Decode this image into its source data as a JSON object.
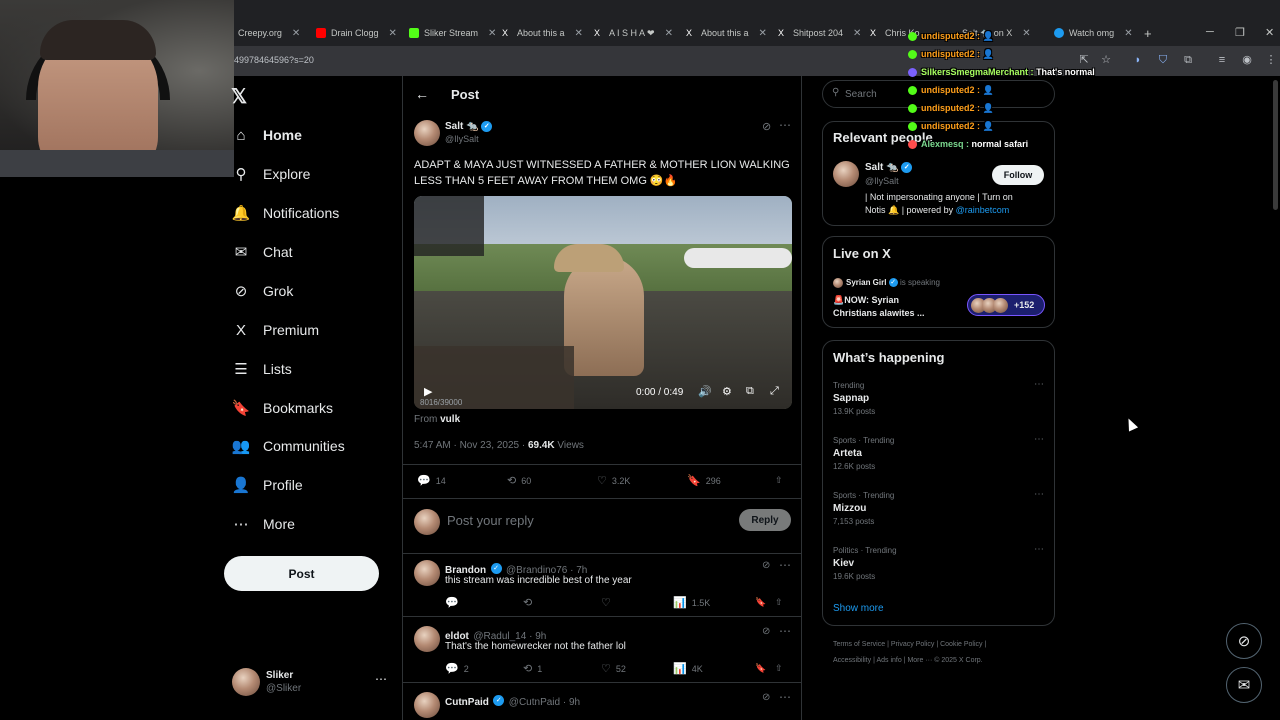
{
  "browser": {
    "tabs": [
      {
        "label": "Creepy.org",
        "color": "#ffffff"
      },
      {
        "label": "Drain Clogg",
        "color": "#ff0000"
      },
      {
        "label": "Sliker Stream",
        "color": "#53fc18"
      },
      {
        "label": "About this a",
        "color": "#ffffff"
      },
      {
        "label": "A I S H A ❤",
        "color": "#ffffff"
      },
      {
        "label": "About this a",
        "color": "#ffffff"
      },
      {
        "label": "Shitpost 204",
        "color": "#ffffff"
      },
      {
        "label": "Chris Ko",
        "color": "#ffffff"
      },
      {
        "label": "Salt 🐀 on X",
        "color": "#ffffff"
      },
      {
        "label": "Watch omg",
        "color": "#1d9bf0"
      }
    ],
    "url": "49978464596?s=20"
  },
  "nav": {
    "items": [
      {
        "label": "Home",
        "icon": "home-icon",
        "glyph": "⌂"
      },
      {
        "label": "Explore",
        "icon": "search-icon",
        "glyph": "⚲"
      },
      {
        "label": "Notifications",
        "icon": "bell-icon",
        "glyph": "🔔"
      },
      {
        "label": "Chat",
        "icon": "mail-icon",
        "glyph": "✉"
      },
      {
        "label": "Grok",
        "icon": "grok-icon",
        "glyph": "⊘"
      },
      {
        "label": "Premium",
        "icon": "x-logo-icon",
        "glyph": "X"
      },
      {
        "label": "Lists",
        "icon": "list-icon",
        "glyph": "☰"
      },
      {
        "label": "Bookmarks",
        "icon": "bookmark-icon",
        "glyph": "🔖"
      },
      {
        "label": "Communities",
        "icon": "people-icon",
        "glyph": "👥"
      },
      {
        "label": "Profile",
        "icon": "person-icon",
        "glyph": "👤"
      },
      {
        "label": "More",
        "icon": "more-circle-icon",
        "glyph": "⋯"
      }
    ],
    "post_label": "Post",
    "account": {
      "name": "Sliker",
      "handle": "@Sliker"
    }
  },
  "post": {
    "header_title": "Post",
    "author_name": "Salt 🐀",
    "author_handle": "@IlySalt",
    "text": "ADAPT & MAYA JUST WITNESSED A FATHER & MOTHER LION WALKING LESS THAN 5 FEET AWAY FROM THEM OMG 😳🔥",
    "video_time": "0:00 / 0:49",
    "video_overlay": "8016/39000",
    "from_label": "From",
    "from_source": "vulk",
    "timestamp": "5:47 AM · Nov 23, 2025 ·",
    "views": "69.4K",
    "views_label": "Views",
    "stats": {
      "replies": "14",
      "reposts": "60",
      "likes": "3.2K",
      "bookmarks": "296"
    },
    "reply_placeholder": "Post your reply",
    "reply_button": "Reply"
  },
  "replies": [
    {
      "name": "Brandon",
      "handle": "@Brandino76 · 7h",
      "text": "this stream was incredible best of the year",
      "verified": true,
      "comments": "",
      "reposts": "",
      "likes": "",
      "views": "1.5K"
    },
    {
      "name": "eldot",
      "handle": "@Radul_14 · 9h",
      "text": "That's the homewrecker not the father lol",
      "verified": false,
      "comments": "2",
      "reposts": "1",
      "likes": "52",
      "views": "4K"
    },
    {
      "name": "CutnPaid",
      "handle": "@CutnPaid · 9h",
      "text": "",
      "verified": true,
      "comments": "",
      "reposts": "",
      "likes": "",
      "views": ""
    }
  ],
  "sidebar": {
    "search_placeholder": "Search",
    "relevant_title": "Relevant people",
    "relevant": {
      "name": "Salt 🐀",
      "handle": "@IlySalt",
      "bio_1": "| Not impersonating anyone | Turn on",
      "bio_2": "Notis 🔔 | powered by",
      "bio_link": "@rainbetcom",
      "follow": "Follow"
    },
    "live_title": "Live on X",
    "live": {
      "host": "Syrian Girl",
      "status": "is speaking",
      "title_1": "🚨NOW: Syrian",
      "title_2": "Christians alawites ...",
      "count": "+152"
    },
    "happening_title": "What’s happening",
    "trends": [
      {
        "category": "Trending",
        "name": "Sapnap",
        "count": "13.9K posts"
      },
      {
        "category": "Sports · Trending",
        "name": "Arteta",
        "count": "12.6K posts"
      },
      {
        "category": "Sports · Trending",
        "name": "Mizzou",
        "count": "7,153 posts"
      },
      {
        "category": "Politics · Trending",
        "name": "Kiev",
        "count": "19.6K posts"
      }
    ],
    "show_more": "Show more",
    "footer_1": "Terms of Service  |  Privacy Policy  |  Cookie Policy  |",
    "footer_2": "Accessibility  |  Ads info  |  More ···  © 2025 X Corp."
  },
  "chat": [
    {
      "user": "undisputed2 :",
      "msg": "👤",
      "color": "#ff9f1a",
      "badge": "#53fc18"
    },
    {
      "user": "undisputed2 :",
      "msg": "👤",
      "color": "#ff9f1a",
      "badge": "#53fc18"
    },
    {
      "user": "SilkersSmegmaMerchant :",
      "msg": "That's normal",
      "color": "#a8ff60",
      "badge": "#7b61ff"
    },
    {
      "user": "undisputed2 :",
      "msg": "👤",
      "color": "#ff9f1a",
      "badge": "#53fc18"
    },
    {
      "user": "undisputed2 :",
      "msg": "👤",
      "color": "#ff9f1a",
      "badge": "#53fc18"
    },
    {
      "user": "undisputed2 :",
      "msg": "👤",
      "color": "#ff9f1a",
      "badge": "#53fc18"
    },
    {
      "user": "Alexmesq :",
      "msg": "normal safari",
      "color": "#7bd88f",
      "badge": "#ff4d4d"
    }
  ],
  "colors": {
    "accent": "#1d9bf0",
    "background": "#000000",
    "border": "#2f3336",
    "muted": "#71767b"
  }
}
